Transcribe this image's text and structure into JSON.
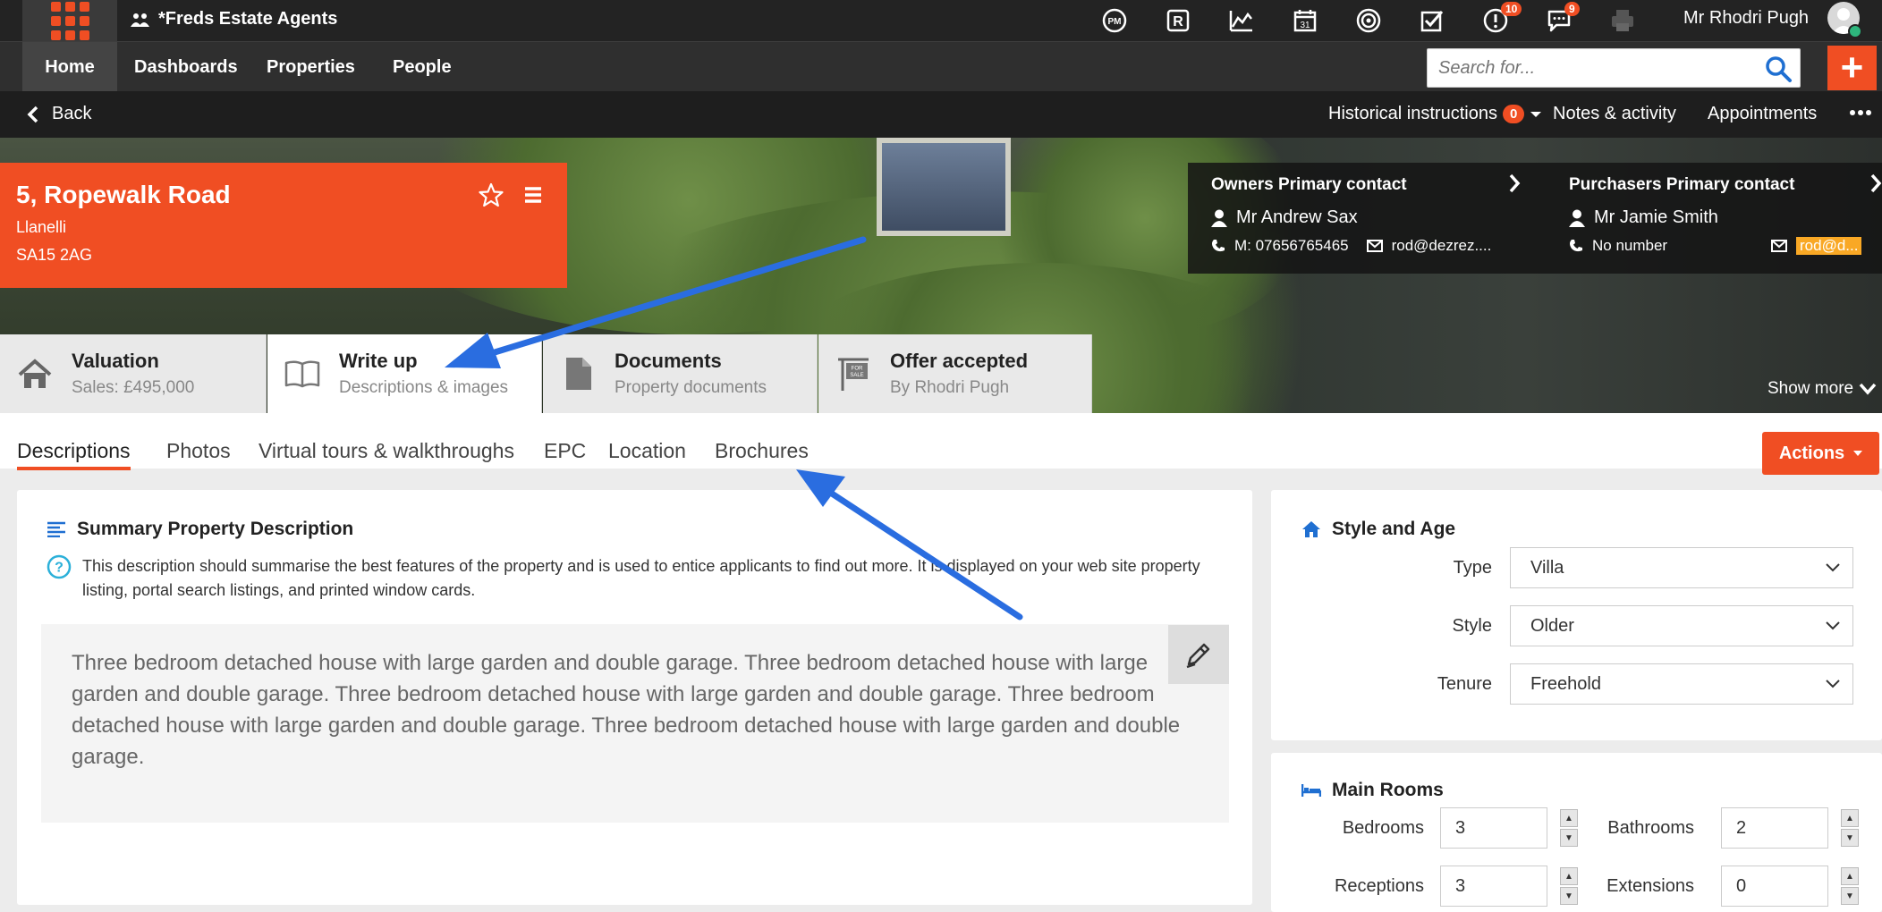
{
  "topbar": {
    "brand": "*Freds Estate Agents",
    "user_name": "Mr Rhodri Pugh",
    "badges": {
      "alerts": "10",
      "messages": "9"
    }
  },
  "nav": {
    "items": [
      "Home",
      "Dashboards",
      "Properties",
      "People"
    ],
    "active": "Home",
    "search_placeholder": "Search for..."
  },
  "subbar": {
    "back": "Back",
    "historical": "Historical instructions",
    "historical_count": "0",
    "notes": "Notes & activity",
    "appointments": "Appointments"
  },
  "property": {
    "address": "5, Ropewalk Road",
    "town": "Llanelli",
    "postcode": "SA15 2AG"
  },
  "contacts": {
    "owners": {
      "heading": "Owners Primary contact",
      "name": "Mr Andrew Sax",
      "phone": "M: 07656765465",
      "email": "rod@dezrez...."
    },
    "purchasers": {
      "heading": "Purchasers Primary contact",
      "name": "Mr Jamie Smith",
      "phone": "No number",
      "email": "rod@d..."
    }
  },
  "big_tabs": [
    {
      "title": "Valuation",
      "sub": "Sales: £495,000"
    },
    {
      "title": "Write up",
      "sub": "Descriptions & images"
    },
    {
      "title": "Documents",
      "sub": "Property documents"
    },
    {
      "title": "Offer accepted",
      "sub": "By Rhodri Pugh"
    }
  ],
  "show_more": "Show more",
  "sub_tabs": [
    "Descriptions",
    "Photos",
    "Virtual tours & walkthroughs",
    "EPC",
    "Location",
    "Brochures"
  ],
  "actions": "Actions",
  "summary": {
    "title": "Summary Property Description",
    "help": "This description should summarise the best features of the property and is used to entice applicants to find out more. It is displayed on your web site property listing, portal search listings, and printed window cards.",
    "text": "Three bedroom detached house with large garden and double garage. Three bedroom detached house with large garden and double garage. Three bedroom detached house with large garden and double garage. Three bedroom detached house with large garden and double garage. Three bedroom detached house with large garden and double garage."
  },
  "style_age": {
    "title": "Style and Age",
    "type_label": "Type",
    "type_value": "Villa",
    "style_label": "Style",
    "style_value": "Older",
    "tenure_label": "Tenure",
    "tenure_value": "Freehold"
  },
  "main_rooms": {
    "title": "Main Rooms",
    "bedrooms_label": "Bedrooms",
    "bedrooms": "3",
    "bathrooms_label": "Bathrooms",
    "bathrooms": "2",
    "receptions_label": "Receptions",
    "receptions": "3",
    "extensions_label": "Extensions",
    "extensions": "0"
  },
  "colors": {
    "accent": "#f04e23",
    "dark": "#232323",
    "arrow": "#2a6de0"
  }
}
